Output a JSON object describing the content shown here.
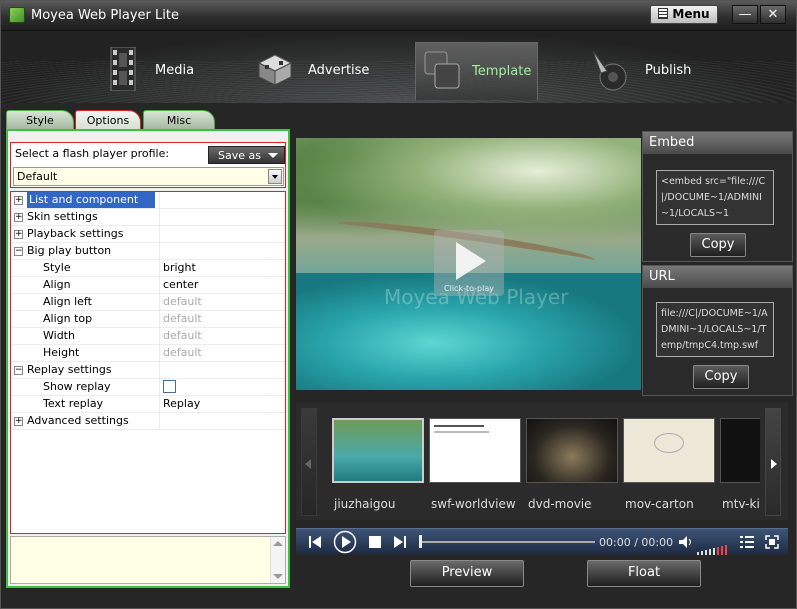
{
  "window": {
    "title": "Moyea Web Player Lite",
    "menu_label": "Menu",
    "minimize": "—",
    "close": "✕"
  },
  "nav": {
    "items": [
      {
        "label": "Media",
        "icon": "film-icon"
      },
      {
        "label": "Advertise",
        "icon": "advertise-icon"
      },
      {
        "label": "Template",
        "icon": "template-icon",
        "selected": true
      },
      {
        "label": "Publish",
        "icon": "publish-icon"
      }
    ]
  },
  "left": {
    "tabs": [
      "Style",
      "Options",
      "Misc"
    ],
    "active_tab": "Options",
    "profile_label": "Select a flash player profile:",
    "save_as": "Save as",
    "profile_value": "Default",
    "properties": [
      {
        "name": "List and component",
        "value": "",
        "level": 0,
        "expander": "+",
        "selected": true
      },
      {
        "name": "Skin settings",
        "value": "",
        "level": 0,
        "expander": "+"
      },
      {
        "name": "Playback settings",
        "value": "",
        "level": 0,
        "expander": "+"
      },
      {
        "name": "Big play button",
        "value": "",
        "level": 0,
        "expander": "−"
      },
      {
        "name": "Style",
        "value": "bright",
        "level": 1
      },
      {
        "name": "Align",
        "value": "center",
        "level": 1
      },
      {
        "name": "Align left",
        "value": "default",
        "level": 1,
        "dim": true
      },
      {
        "name": "Align top",
        "value": "default",
        "level": 1,
        "dim": true
      },
      {
        "name": "Width",
        "value": "default",
        "level": 1,
        "dim": true
      },
      {
        "name": "Height",
        "value": "default",
        "level": 1,
        "dim": true
      },
      {
        "name": "Replay settings",
        "value": "",
        "level": 0,
        "expander": "−"
      },
      {
        "name": "Show replay",
        "value": "",
        "level": 1,
        "checkbox": true
      },
      {
        "name": "Text replay",
        "value": "Replay",
        "level": 1
      },
      {
        "name": "Advanced settings",
        "value": "",
        "level": 0,
        "expander": "+"
      }
    ]
  },
  "preview": {
    "click_to_play": "Click-to-play",
    "watermark": "Moyea Web Player"
  },
  "embed": {
    "header": "Embed",
    "code": "<embed src=\"file:///C|/DOCUME~1/ADMINI~1/LOCALS~1",
    "copy": "Copy"
  },
  "url": {
    "header": "URL",
    "code": "file:///C|/DOCUME~1/ADMINI~1/LOCALS~1/Temp/tmpC4.tmp.swf",
    "copy": "Copy"
  },
  "playlist": [
    {
      "caption": "jiuzhaigou"
    },
    {
      "caption": "swf-worldview"
    },
    {
      "caption": "dvd-movie"
    },
    {
      "caption": "mov-carton"
    },
    {
      "caption": "mtv-kis"
    }
  ],
  "controls": {
    "time": "00:00 / 00:00",
    "progress": 0
  },
  "buttons": {
    "preview": "Preview",
    "float": "Float"
  }
}
